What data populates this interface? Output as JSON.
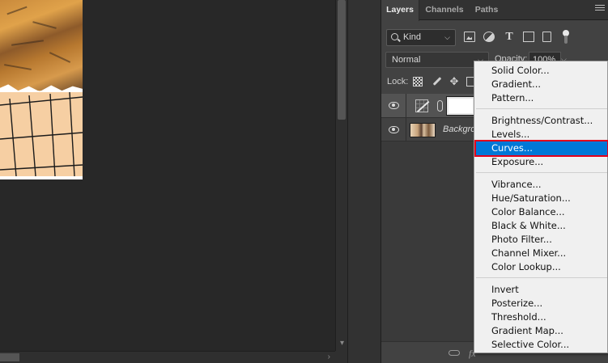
{
  "layers_panel": {
    "tabs": [
      "Layers",
      "Channels",
      "Paths"
    ],
    "filter": {
      "kind_label": "Kind"
    },
    "blend_mode": "Normal",
    "opacity_label": "Opacity:",
    "opacity_value": "100%",
    "lock_label": "Lock:",
    "layers": [
      {
        "name": "",
        "type": "curves-adjustment",
        "visible": true,
        "selected": true
      },
      {
        "name": "Backgrou",
        "type": "image",
        "visible": true,
        "selected": false
      }
    ]
  },
  "adjustment_menu": {
    "groups": [
      [
        "Solid Color...",
        "Gradient...",
        "Pattern..."
      ],
      [
        "Brightness/Contrast...",
        "Levels...",
        "Curves...",
        "Exposure..."
      ],
      [
        "Vibrance...",
        "Hue/Saturation...",
        "Color Balance...",
        "Black & White...",
        "Photo Filter...",
        "Channel Mixer...",
        "Color Lookup..."
      ],
      [
        "Invert",
        "Posterize...",
        "Threshold...",
        "Gradient Map...",
        "Selective Color..."
      ]
    ],
    "highlighted": "Curves...",
    "highlight_color": "#0078d7",
    "highlight_border_color": "#e3001b"
  },
  "icons": {
    "scroll_down": "▾",
    "scroll_right": "›",
    "caret": "⌵",
    "type_tool": "T",
    "move": "✥",
    "fx": "fx"
  }
}
